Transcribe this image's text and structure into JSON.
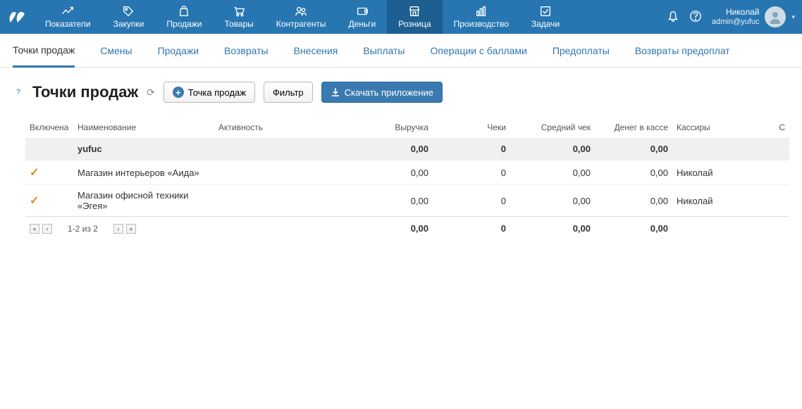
{
  "topnav": {
    "items": [
      {
        "label": "Показатели"
      },
      {
        "label": "Закупки"
      },
      {
        "label": "Продажи"
      },
      {
        "label": "Товары"
      },
      {
        "label": "Контрагенты"
      },
      {
        "label": "Деньги"
      },
      {
        "label": "Розница",
        "active": true
      },
      {
        "label": "Производство"
      },
      {
        "label": "Задачи"
      }
    ],
    "user": {
      "name": "Николай",
      "login": "admin@yufuc"
    }
  },
  "subnav": {
    "items": [
      {
        "label": "Точки продаж",
        "active": true
      },
      {
        "label": "Смены"
      },
      {
        "label": "Продажи"
      },
      {
        "label": "Возвраты"
      },
      {
        "label": "Внесения"
      },
      {
        "label": "Выплаты"
      },
      {
        "label": "Операции с баллами"
      },
      {
        "label": "Предоплаты"
      },
      {
        "label": "Возвраты предоплат"
      }
    ]
  },
  "toolbar": {
    "title": "Точки продаж",
    "add_button": "Точка продаж",
    "filter_button": "Фильтр",
    "download_button": "Скачать приложение",
    "help": "?"
  },
  "table": {
    "headers": {
      "enabled": "Включена",
      "name": "Наименование",
      "activity": "Активность",
      "revenue": "Выручка",
      "checks": "Чеки",
      "avg_check": "Средний чек",
      "cash": "Денег в кассе",
      "cashiers": "Кассиры",
      "last": "С"
    },
    "group": {
      "name": "yufuc",
      "revenue": "0,00",
      "checks": "0",
      "avg_check": "0,00",
      "cash": "0,00"
    },
    "rows": [
      {
        "enabled": "✓",
        "name": "Магазин интерьеров «Аида»",
        "revenue": "0,00",
        "checks": "0",
        "avg_check": "0,00",
        "cash": "0,00",
        "cashiers": "Николай"
      },
      {
        "enabled": "✓",
        "name": "Магазин офисной техники «Эгея»",
        "revenue": "0,00",
        "checks": "0",
        "avg_check": "0,00",
        "cash": "0,00",
        "cashiers": "Николай"
      }
    ],
    "footer": {
      "pager": "1-2 из 2",
      "revenue": "0,00",
      "checks": "0",
      "avg_check": "0,00",
      "cash": "0,00"
    }
  }
}
